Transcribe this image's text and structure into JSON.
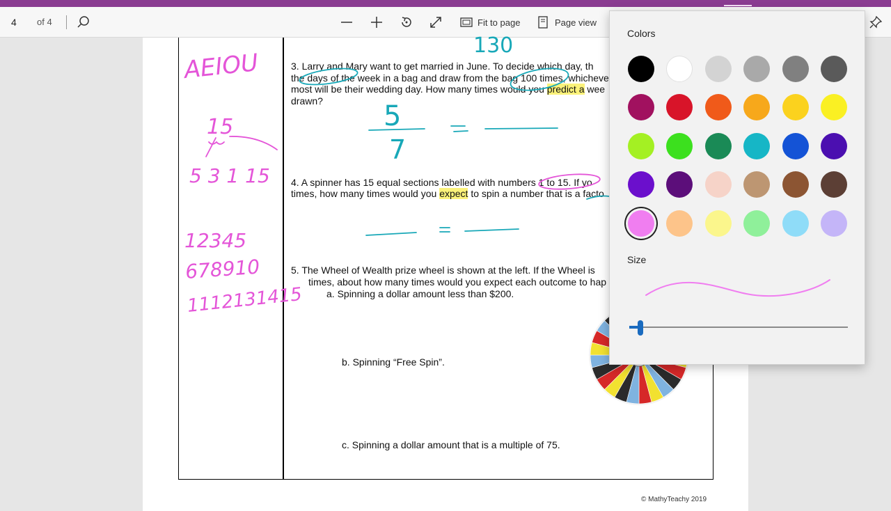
{
  "toolbar": {
    "page_number": "4",
    "page_count": "of 4",
    "fit_label": "Fit to page",
    "view_label": "Page view"
  },
  "document": {
    "q3_line1": "3.   Larry and Mary want to get married in June.  To decide which day, th",
    "q3_line2_a": "the days of the week in a bag and draw from the bag 100 times, whicheve",
    "q3_line3_a": "most will be their wedding day.  How many times would you ",
    "q3_line3_hl": "predict a",
    "q3_line3_b": " wee",
    "q3_line4": "drawn?",
    "q4_line1": "4.   A spinner has 15 equal sections labelled with numbers 1 to 15.  If yo",
    "q4_line2_a": "times, how many times would you ",
    "q4_line2_hl": "expect",
    "q4_line2_b": " to spin a number that is a facto",
    "q5_line1": "5.   The Wheel of Wealth prize wheel is shown at the left.  If the Wheel is",
    "q5_line2": "times, about how many times would you expect each outcome to hap",
    "q5_a": "a.    Spinning a dollar amount less than $200.",
    "q5_b": "b.    Spinning “Free Spin”.",
    "q5_c": "c.    Spinning a dollar amount that is a multiple of 75.",
    "footer": "© MathyTeachy 2019"
  },
  "ink": {
    "vowels": "AEIOU",
    "fifteen": "15",
    "factors": "5  3    1  15",
    "row1": "12345",
    "row2": "678910",
    "row3": "1112131415",
    "top_num": "130",
    "num5": "5",
    "den7": "7"
  },
  "pen_panel": {
    "colors_label": "Colors",
    "size_label": "Size",
    "selected_color": "#f07ef0",
    "size_value": 0.05,
    "swatches": [
      "#000000",
      "#ffffff",
      "#d3d3d3",
      "#a9a9a9",
      "#808080",
      "#5a5a5a",
      "#a1115f",
      "#d81429",
      "#f05a1a",
      "#f7a81b",
      "#fbd21e",
      "#faf023",
      "#a4f023",
      "#3ce01e",
      "#1a8a56",
      "#16b6c6",
      "#1453d6",
      "#4b0fb0",
      "#6b0fcc",
      "#5c0e7a",
      "#f6d3c8",
      "#bd9672",
      "#8c5533",
      "#5c3f35",
      "#f07ef0",
      "#fdc48a",
      "#fbf68c",
      "#8ff09a",
      "#8fdcf8",
      "#c4b5f8"
    ]
  }
}
